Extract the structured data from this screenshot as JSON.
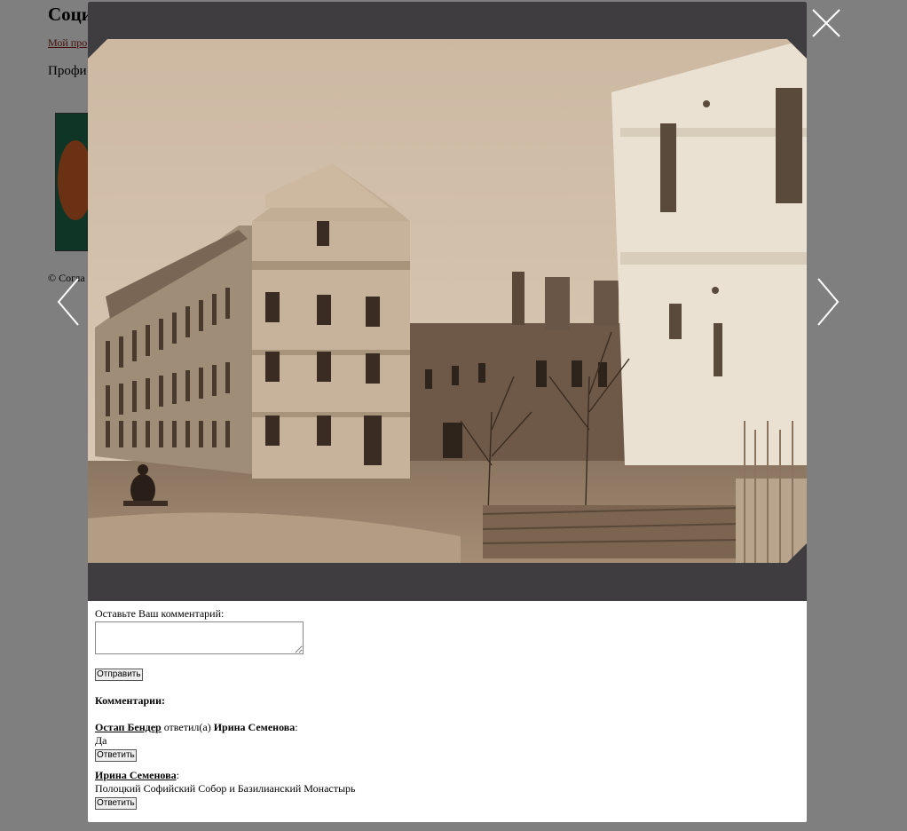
{
  "background": {
    "title": "Соци",
    "link": "Мой про",
    "profile": "Профи",
    "copyright": "© Согла"
  },
  "comment_form": {
    "label": "Оставьте Ваш комментарий:",
    "textarea_value": "",
    "submit_label": "Отправить"
  },
  "comments": {
    "heading": "Комментарии:",
    "items": [
      {
        "author": "Остап Бендер",
        "replied": " ответил(а) ",
        "target": "Ирина Семенова",
        "colon": ":",
        "text": "Да",
        "reply_label": "Ответить"
      },
      {
        "author": "Ирина Семенова",
        "colon": ":",
        "text": "Полоцкий Софийский Собор и Базилианский Монастырь",
        "reply_label": "Ответить"
      }
    ]
  },
  "icons": {
    "close": "close-icon",
    "prev": "chevron-left-icon",
    "next": "chevron-right-icon"
  },
  "colors": {
    "overlay": "#808080",
    "frame": "#3f3d3f",
    "sepia_sky": "#d6c3ad",
    "link": "#8b1a1a"
  }
}
